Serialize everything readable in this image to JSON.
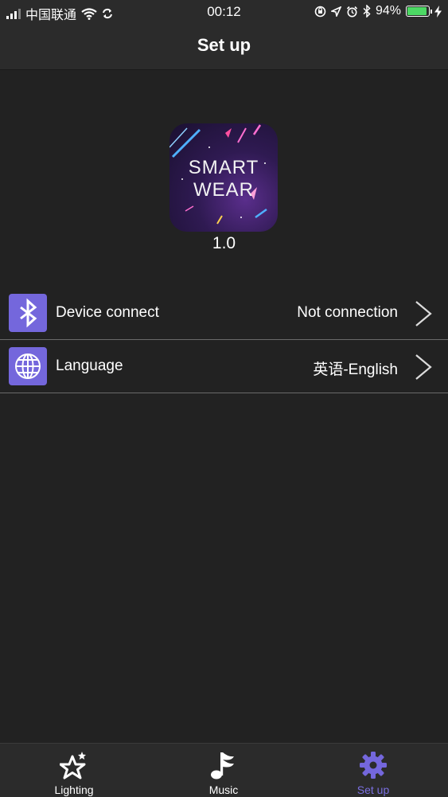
{
  "status_bar": {
    "carrier": "中国联通",
    "time": "00:12",
    "battery_percent": "94%",
    "battery_level": 0.94,
    "icons": [
      "signal-icon",
      "wifi-icon",
      "sync-icon",
      "orientation-lock-icon",
      "location-icon",
      "alarm-icon",
      "bluetooth-icon",
      "battery-icon",
      "charging-icon"
    ]
  },
  "nav": {
    "title": "Set up"
  },
  "app": {
    "logo_line1": "SMART",
    "logo_line2": "WEAR",
    "version": "1.0"
  },
  "settings": [
    {
      "icon": "bluetooth-icon",
      "label": "Device connect",
      "value": "Not connection"
    },
    {
      "icon": "globe-icon",
      "label": "Language",
      "value": "英语-English"
    }
  ],
  "tabs": [
    {
      "icon": "star-icon",
      "label": "Lighting",
      "active": false
    },
    {
      "icon": "music-note-icon",
      "label": "Music",
      "active": false
    },
    {
      "icon": "gear-icon",
      "label": "Set up",
      "active": true
    }
  ],
  "colors": {
    "background": "#222222",
    "bar": "#2b2b2b",
    "accent": "#7467dc",
    "active_tab": "#7a6fe0",
    "battery": "#4cd964"
  }
}
